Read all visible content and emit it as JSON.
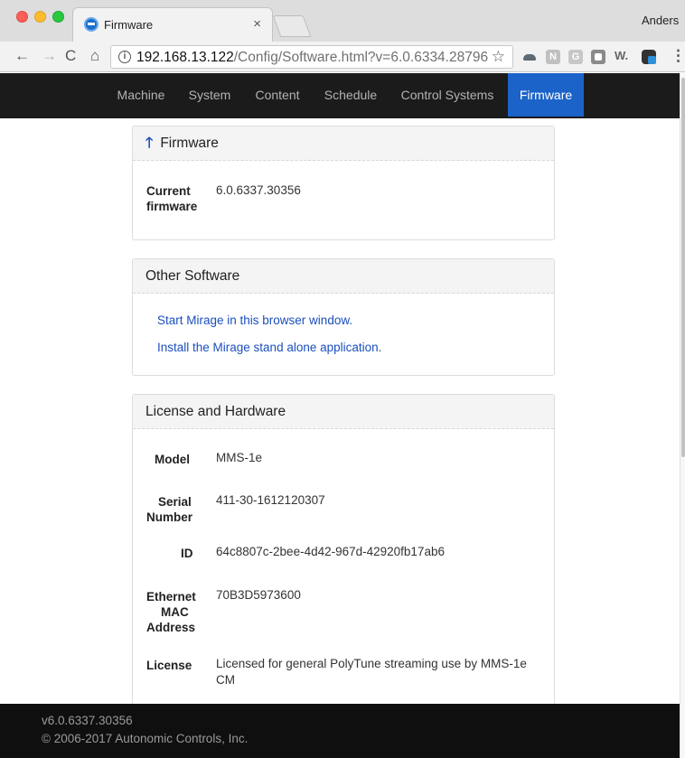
{
  "browser": {
    "tab_title": "Firmware",
    "tab_close": "×",
    "profile_name": "Anders",
    "url_host": "192.168.13.122",
    "url_path": "/Config/Software.html?v=6.0.6334.28796",
    "ext_n_label": "N",
    "ext_g_label": "G",
    "ext_w_label": "W.",
    "menu_label": "⋮"
  },
  "nav": {
    "items": [
      "Machine",
      "System",
      "Content",
      "Schedule",
      "Control Systems",
      "Firmware"
    ],
    "active": "Firmware"
  },
  "firmware_panel": {
    "title": "Firmware",
    "current_label_1": "Current",
    "current_label_2": "firmware",
    "current_value": "6.0.6337.30356"
  },
  "other_software": {
    "title": "Other Software",
    "link_start": "Start Mirage in this browser window.",
    "link_install": "Install the Mirage stand alone application."
  },
  "license": {
    "title": "License and Hardware",
    "model_label": "Model",
    "model_value": "MMS-1e",
    "serial_label_1": "Serial",
    "serial_label_2": "Number",
    "serial_value": "411-30-1612120307",
    "id_label": "ID",
    "id_value": "64c8807c-2bee-4d42-967d-42920fb17ab6",
    "mac_label_1": "Ethernet",
    "mac_label_2": "MAC",
    "mac_label_3": "Address",
    "mac_value": "70B3D5973600",
    "license_label": "License",
    "license_value_1": "Licensed for general PolyTune streaming use by MMS-1e",
    "license_value_2": "CM"
  },
  "footer": {
    "version": "v6.0.6337.30356",
    "copyright": "© 2006-2017 Autonomic Controls, Inc."
  },
  "colors": {
    "nav_bg": "#1b1b1b",
    "nav_active": "#1b63c8",
    "link": "#1b4fbc",
    "footer_bg": "#0f0f0f"
  }
}
